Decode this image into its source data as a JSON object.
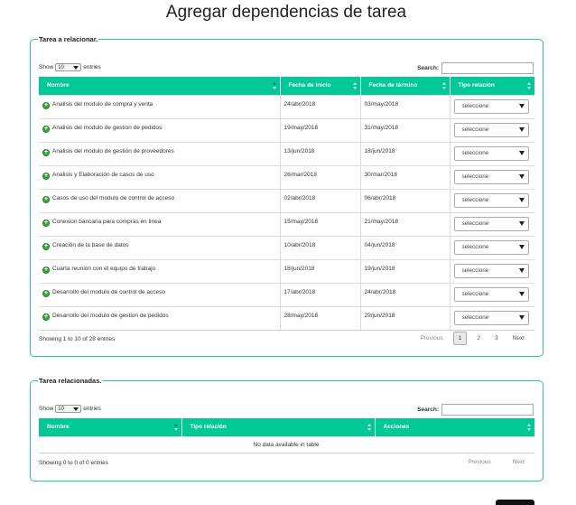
{
  "page": {
    "title": "Agregar dependencias de tarea"
  },
  "colors": {
    "accent": "#00c896",
    "border": "#2ec4a0"
  },
  "panel1": {
    "legend": "Tarea a relacionar.",
    "show_label": "Show",
    "length_value": "10",
    "entries_label": "entries",
    "search_label": "Search:",
    "columns": [
      "Nombre",
      "Fecha de inicio",
      "Fecha de término",
      "Tipo relación"
    ],
    "rows": [
      {
        "name": "Analisis del modulo de compra y venta",
        "start": "24/abr/2018",
        "end": "03/may/2018",
        "relation": "seleccione"
      },
      {
        "name": "Analisis del modulo de gestion de pedidos",
        "start": "19/may/2018",
        "end": "31/may/2018",
        "relation": "seleccione"
      },
      {
        "name": "Analisis del modulo de gestión de proveedores",
        "start": "13/jun/2018",
        "end": "18/jun/2018",
        "relation": "seleccione"
      },
      {
        "name": "Analisis y Elaboración de casos de uso",
        "start": "26/mar/2018",
        "end": "30/mar/2018",
        "relation": "seleccione"
      },
      {
        "name": "Casos de uso del modulo de control de acceso",
        "start": "02/abr/2018",
        "end": "06/abr/2018",
        "relation": "seleccione"
      },
      {
        "name": "Conexion bancaria para compras en linea",
        "start": "15/may/2018",
        "end": "21/may/2018",
        "relation": "seleccione"
      },
      {
        "name": "Creación de la base de datos",
        "start": "10/abr/2018",
        "end": "04/jun/2018",
        "relation": "seleccione"
      },
      {
        "name": "Cuarta reunión con el equipo de trabajo",
        "start": "18/jun/2018",
        "end": "19/jun/2018",
        "relation": "seleccione"
      },
      {
        "name": "Desarrollo del modulo de control de acceso",
        "start": "17/abr/2018",
        "end": "24/abr/2018",
        "relation": "seleccione"
      },
      {
        "name": "Desarrollo del modulo de gestion de pedidos",
        "start": "28/may/2018",
        "end": "29/jun/2018",
        "relation": "seleccione"
      }
    ],
    "info": "Showing 1 to 10 of 28 entries",
    "pager": {
      "previous": "Previous",
      "pages": [
        "1",
        "2",
        "3"
      ],
      "next": "Next"
    }
  },
  "panel2": {
    "legend": "Tarea relacionadas.",
    "show_label": "Show",
    "length_value": "10",
    "entries_label": "entries",
    "search_label": "Search:",
    "columns": [
      "Nombre",
      "Tipo relación",
      "Acciones"
    ],
    "empty": "No data available in table",
    "info": "Showing 0 to 0 of 0 entries",
    "pager": {
      "previous": "Previous",
      "next": "Next"
    }
  }
}
